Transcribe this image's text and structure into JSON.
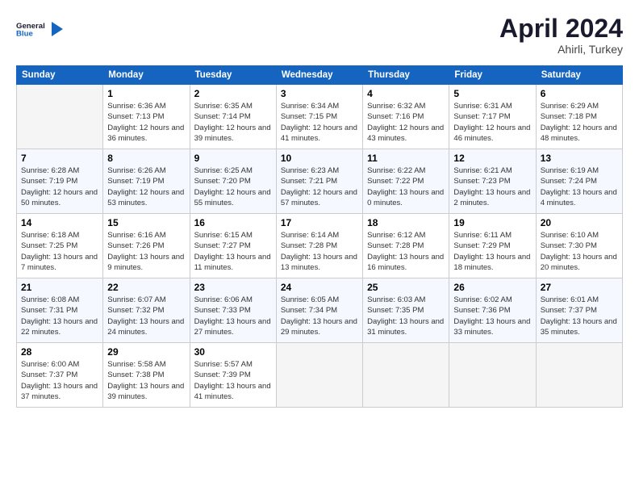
{
  "header": {
    "logo_general": "General",
    "logo_blue": "Blue",
    "month_title": "April 2024",
    "location": "Ahirli, Turkey"
  },
  "columns": [
    "Sunday",
    "Monday",
    "Tuesday",
    "Wednesday",
    "Thursday",
    "Friday",
    "Saturday"
  ],
  "weeks": [
    [
      {
        "day": "",
        "sunrise": "",
        "sunset": "",
        "daylight": ""
      },
      {
        "day": "1",
        "sunrise": "Sunrise: 6:36 AM",
        "sunset": "Sunset: 7:13 PM",
        "daylight": "Daylight: 12 hours and 36 minutes."
      },
      {
        "day": "2",
        "sunrise": "Sunrise: 6:35 AM",
        "sunset": "Sunset: 7:14 PM",
        "daylight": "Daylight: 12 hours and 39 minutes."
      },
      {
        "day": "3",
        "sunrise": "Sunrise: 6:34 AM",
        "sunset": "Sunset: 7:15 PM",
        "daylight": "Daylight: 12 hours and 41 minutes."
      },
      {
        "day": "4",
        "sunrise": "Sunrise: 6:32 AM",
        "sunset": "Sunset: 7:16 PM",
        "daylight": "Daylight: 12 hours and 43 minutes."
      },
      {
        "day": "5",
        "sunrise": "Sunrise: 6:31 AM",
        "sunset": "Sunset: 7:17 PM",
        "daylight": "Daylight: 12 hours and 46 minutes."
      },
      {
        "day": "6",
        "sunrise": "Sunrise: 6:29 AM",
        "sunset": "Sunset: 7:18 PM",
        "daylight": "Daylight: 12 hours and 48 minutes."
      }
    ],
    [
      {
        "day": "7",
        "sunrise": "Sunrise: 6:28 AM",
        "sunset": "Sunset: 7:19 PM",
        "daylight": "Daylight: 12 hours and 50 minutes."
      },
      {
        "day": "8",
        "sunrise": "Sunrise: 6:26 AM",
        "sunset": "Sunset: 7:19 PM",
        "daylight": "Daylight: 12 hours and 53 minutes."
      },
      {
        "day": "9",
        "sunrise": "Sunrise: 6:25 AM",
        "sunset": "Sunset: 7:20 PM",
        "daylight": "Daylight: 12 hours and 55 minutes."
      },
      {
        "day": "10",
        "sunrise": "Sunrise: 6:23 AM",
        "sunset": "Sunset: 7:21 PM",
        "daylight": "Daylight: 12 hours and 57 minutes."
      },
      {
        "day": "11",
        "sunrise": "Sunrise: 6:22 AM",
        "sunset": "Sunset: 7:22 PM",
        "daylight": "Daylight: 13 hours and 0 minutes."
      },
      {
        "day": "12",
        "sunrise": "Sunrise: 6:21 AM",
        "sunset": "Sunset: 7:23 PM",
        "daylight": "Daylight: 13 hours and 2 minutes."
      },
      {
        "day": "13",
        "sunrise": "Sunrise: 6:19 AM",
        "sunset": "Sunset: 7:24 PM",
        "daylight": "Daylight: 13 hours and 4 minutes."
      }
    ],
    [
      {
        "day": "14",
        "sunrise": "Sunrise: 6:18 AM",
        "sunset": "Sunset: 7:25 PM",
        "daylight": "Daylight: 13 hours and 7 minutes."
      },
      {
        "day": "15",
        "sunrise": "Sunrise: 6:16 AM",
        "sunset": "Sunset: 7:26 PM",
        "daylight": "Daylight: 13 hours and 9 minutes."
      },
      {
        "day": "16",
        "sunrise": "Sunrise: 6:15 AM",
        "sunset": "Sunset: 7:27 PM",
        "daylight": "Daylight: 13 hours and 11 minutes."
      },
      {
        "day": "17",
        "sunrise": "Sunrise: 6:14 AM",
        "sunset": "Sunset: 7:28 PM",
        "daylight": "Daylight: 13 hours and 13 minutes."
      },
      {
        "day": "18",
        "sunrise": "Sunrise: 6:12 AM",
        "sunset": "Sunset: 7:28 PM",
        "daylight": "Daylight: 13 hours and 16 minutes."
      },
      {
        "day": "19",
        "sunrise": "Sunrise: 6:11 AM",
        "sunset": "Sunset: 7:29 PM",
        "daylight": "Daylight: 13 hours and 18 minutes."
      },
      {
        "day": "20",
        "sunrise": "Sunrise: 6:10 AM",
        "sunset": "Sunset: 7:30 PM",
        "daylight": "Daylight: 13 hours and 20 minutes."
      }
    ],
    [
      {
        "day": "21",
        "sunrise": "Sunrise: 6:08 AM",
        "sunset": "Sunset: 7:31 PM",
        "daylight": "Daylight: 13 hours and 22 minutes."
      },
      {
        "day": "22",
        "sunrise": "Sunrise: 6:07 AM",
        "sunset": "Sunset: 7:32 PM",
        "daylight": "Daylight: 13 hours and 24 minutes."
      },
      {
        "day": "23",
        "sunrise": "Sunrise: 6:06 AM",
        "sunset": "Sunset: 7:33 PM",
        "daylight": "Daylight: 13 hours and 27 minutes."
      },
      {
        "day": "24",
        "sunrise": "Sunrise: 6:05 AM",
        "sunset": "Sunset: 7:34 PM",
        "daylight": "Daylight: 13 hours and 29 minutes."
      },
      {
        "day": "25",
        "sunrise": "Sunrise: 6:03 AM",
        "sunset": "Sunset: 7:35 PM",
        "daylight": "Daylight: 13 hours and 31 minutes."
      },
      {
        "day": "26",
        "sunrise": "Sunrise: 6:02 AM",
        "sunset": "Sunset: 7:36 PM",
        "daylight": "Daylight: 13 hours and 33 minutes."
      },
      {
        "day": "27",
        "sunrise": "Sunrise: 6:01 AM",
        "sunset": "Sunset: 7:37 PM",
        "daylight": "Daylight: 13 hours and 35 minutes."
      }
    ],
    [
      {
        "day": "28",
        "sunrise": "Sunrise: 6:00 AM",
        "sunset": "Sunset: 7:37 PM",
        "daylight": "Daylight: 13 hours and 37 minutes."
      },
      {
        "day": "29",
        "sunrise": "Sunrise: 5:58 AM",
        "sunset": "Sunset: 7:38 PM",
        "daylight": "Daylight: 13 hours and 39 minutes."
      },
      {
        "day": "30",
        "sunrise": "Sunrise: 5:57 AM",
        "sunset": "Sunset: 7:39 PM",
        "daylight": "Daylight: 13 hours and 41 minutes."
      },
      {
        "day": "",
        "sunrise": "",
        "sunset": "",
        "daylight": ""
      },
      {
        "day": "",
        "sunrise": "",
        "sunset": "",
        "daylight": ""
      },
      {
        "day": "",
        "sunrise": "",
        "sunset": "",
        "daylight": ""
      },
      {
        "day": "",
        "sunrise": "",
        "sunset": "",
        "daylight": ""
      }
    ]
  ]
}
